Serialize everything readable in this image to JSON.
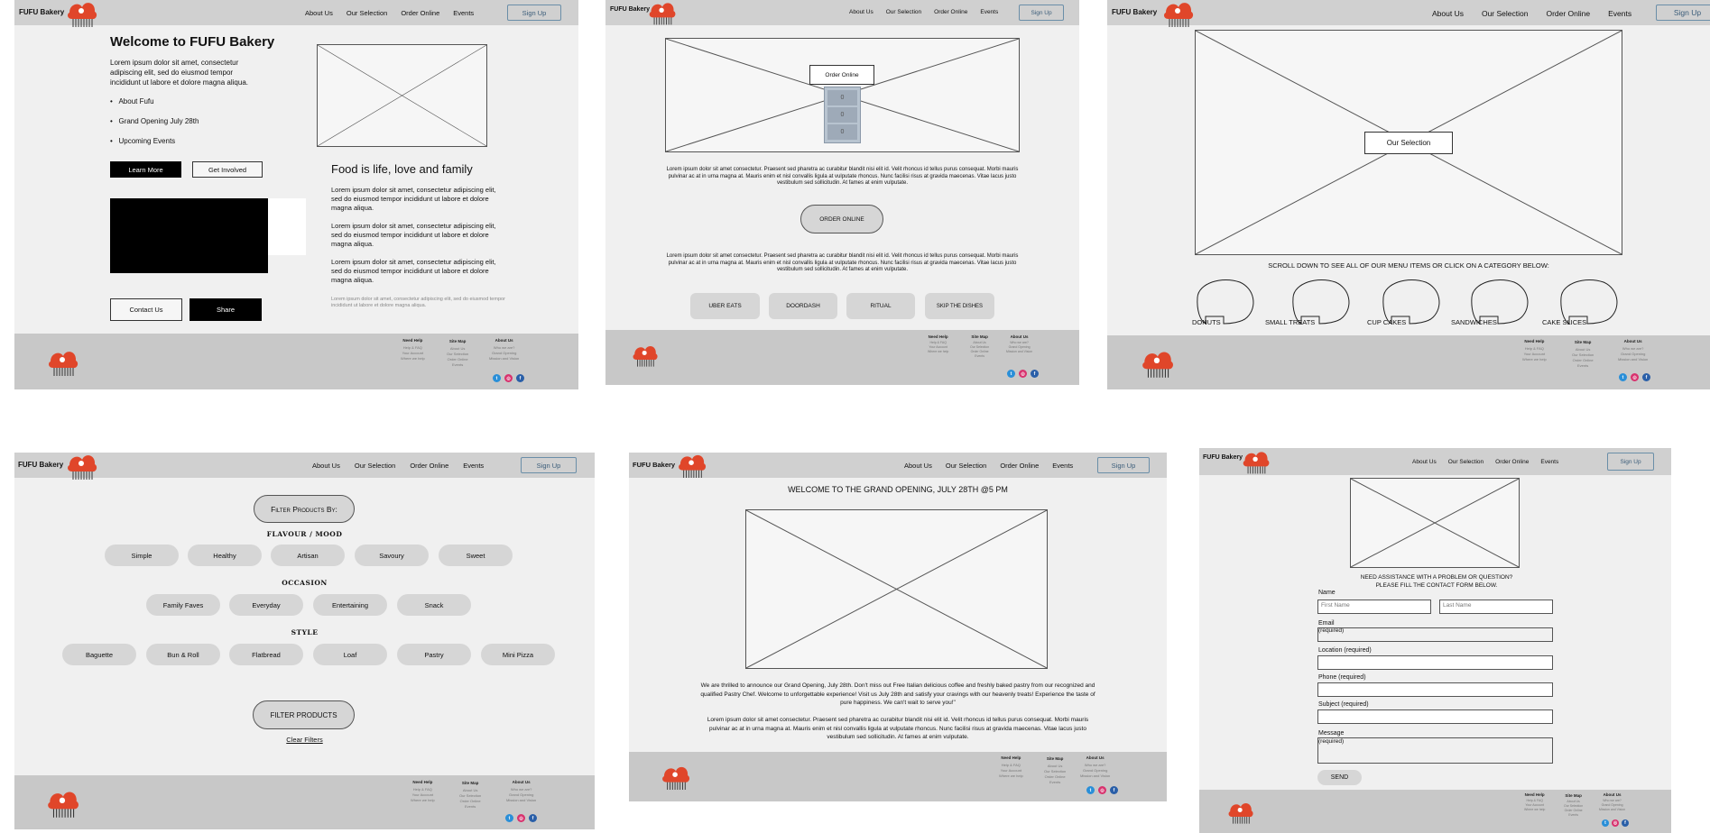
{
  "brand": "FUFU Bakery",
  "nav": [
    "About Us",
    "Our Selection",
    "Order Online",
    "Events"
  ],
  "signup": "Sign Up",
  "footer": {
    "help_title": "Need Help",
    "help_items": [
      "Help & FAQ",
      "Your Account",
      "Where we help"
    ],
    "sitemap_title": "Site Map",
    "sitemap_items": [
      "About Us",
      "Our Selection",
      "Order Online",
      "Events"
    ],
    "about_title": "About Us",
    "about_items": [
      "Who we are?",
      "Grand Opening",
      "Mission and Vision"
    ]
  },
  "home": {
    "title": "Welcome to FUFU Bakery",
    "intro": "Lorem ipsum dolor sit amet, consectetur adipiscing elit, sed do eiusmod tempor incididunt ut labore et dolore magna aliqua.",
    "bullets": [
      "About Fufu",
      "Grand Opening July 28th",
      "Upcoming Events"
    ],
    "learn_more": "Learn More",
    "get_involved": "Get Involved",
    "contact_us": "Contact Us",
    "share": "Share",
    "tagline": "Food is life, love and family",
    "para": "Lorem ipsum dolor sit amet, consectetur adipiscing elit, sed do eiusmod tempor incididunt ut labore et dolore magna aliqua.",
    "small": "Lorem ipsum dolor sit amet, consectetur adipiscing elit, sed do eiusmod tempor incididunt ut labore et dolore magna aliqua."
  },
  "order": {
    "overlay": "Order Online",
    "stack": [
      "0",
      "0",
      "0"
    ],
    "para": "Lorem ipsum dolor sit amet consectetur. Praesent sed pharetra ac curabitur blandit nisi elit id. Velit rhoncus id tellus purus consequat. Morbi mauris pulvinar ac at in urna magna at. Mauris enim et nisl convallis ligula at vulputate rhoncus. Nunc facilisi risus at gravida maecenas. Vitae lacus justo vestibulum sed sollicitudin. At fames at enim vulputate.",
    "order_button": "ORDER ONLINE",
    "partners": [
      "UBER EATS",
      "DOORDASH",
      "RITUAL",
      "SKIP THE DISHES"
    ]
  },
  "selection": {
    "overlay": "Our Selection",
    "scroll_text": "SCROLL DOWN TO SEE ALL OF OUR MENU ITEMS OR CLICK ON A CATEGORY BELOW:",
    "categories": [
      "DONUTS",
      "SMALL TREATS",
      "CUP CAKES",
      "SANDWICHES",
      "CAKE SLICES"
    ]
  },
  "filter": {
    "title": "Filter Products By:",
    "flavour_title": "FLAVOUR / MOOD",
    "flavour": [
      "Simple",
      "Healthy",
      "Artisan",
      "Savoury",
      "Sweet"
    ],
    "occasion_title": "OCCASION",
    "occasion": [
      "Family Faves",
      "Everyday",
      "Entertaining",
      "Snack"
    ],
    "style_title": "STYLE",
    "style": [
      "Baguette",
      "Bun & Roll",
      "Flatbread",
      "Loaf",
      "Pastry",
      "Mini Pizza"
    ],
    "apply": "FILTER PRODUCTS",
    "clear": "Clear Filters"
  },
  "events": {
    "title": "WELCOME TO THE GRAND OPENING, JULY 28TH @5 PM",
    "para1": "We are thrilled to announce our Grand Opening, July 28th. Don't miss out Free Italian delicious coffee and freshly baked pastry from our recognized and qualified Pastry Chef. Welcome to unforgettable experience! Visit us July 28th and satisfy your cravings with our heavenly treats! Experience the taste of pure happiness. We can't wait to serve you!\"",
    "para2": "Lorem ipsum dolor sit amet consectetur. Praesent sed pharetra ac curabitur blandit nisi elit id. Velit rhoncus id tellus purus consequat. Morbi mauris pulvinar ac at in urna magna at. Mauris enim et nisl convallis ligula at vulputate rhoncus. Nunc facilisi risus at gravida maecenas. Vitae lacus justo vestibulum sed sollicitudin. At fames at enim vulputate."
  },
  "contact": {
    "heading1": "NEED ASSISTANCE WITH A PROBLEM OR QUESTION?",
    "heading2": "PLEASE FILL THE CONTACT FORM BELOW.",
    "name_label": "Name",
    "first_placeholder": "First Name",
    "last_placeholder": "Last Name",
    "email_label": "Email",
    "email_hint": "(required)",
    "location_label": "Location (required)",
    "phone_label": "Phone (required)",
    "subject_label": "Subject (required)",
    "message_label": "Message",
    "message_hint": "(required)",
    "send": "SEND"
  },
  "colors": {
    "header": "#d0d0d0",
    "page": "#f0f0f0",
    "footer": "#c8c8c8",
    "logo": "#e0462a",
    "signup_border": "#6a8ea8"
  }
}
